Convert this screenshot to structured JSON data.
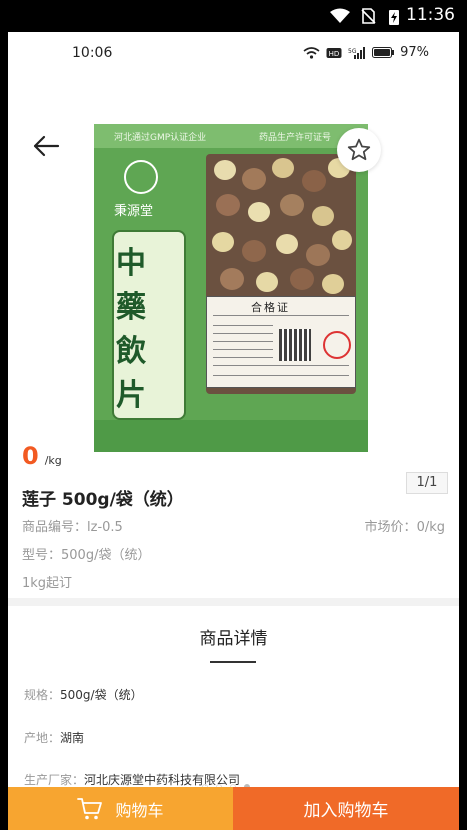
{
  "system_status": {
    "time": "11:36"
  },
  "captured_status": {
    "time": "10:06",
    "battery": "97%"
  },
  "product": {
    "image_counter": "1/1",
    "package": {
      "top_left": "河北通过GMP认证企业",
      "top_right": "药品生产许可证号",
      "brand": "秉源堂",
      "vertical_chars": [
        "中",
        "藥",
        "飲",
        "片"
      ],
      "cert_title": "合格证"
    },
    "price": "0",
    "price_unit": "/kg",
    "title": "莲子 500g/袋（统）",
    "code_label": "商品编号：",
    "code_value": "lz-0.5",
    "market_label": "市场价：",
    "market_value": "0/kg",
    "model_label": "型号：",
    "model_value": "500g/袋（统）",
    "min_order": "1kg起订"
  },
  "details": {
    "heading": "商品详情",
    "specs": [
      {
        "key": "规格：",
        "value": "500g/袋（统）"
      },
      {
        "key": "产地：",
        "value": "湖南"
      },
      {
        "key": "生产厂家：",
        "value": "河北庆源堂中药科技有限公司"
      }
    ]
  },
  "actions": {
    "cart_label": "购物车",
    "add_to_cart_label": "加入购物车"
  },
  "colors": {
    "accent_price": "#f25a22",
    "cart_button": "#f7a530",
    "add_button": "#f06a28",
    "package_green": "#5fa653"
  },
  "icons": [
    "back-arrow-icon",
    "star-icon",
    "cart-icon",
    "wifi-icon",
    "battery-icon",
    "signal-icon"
  ]
}
